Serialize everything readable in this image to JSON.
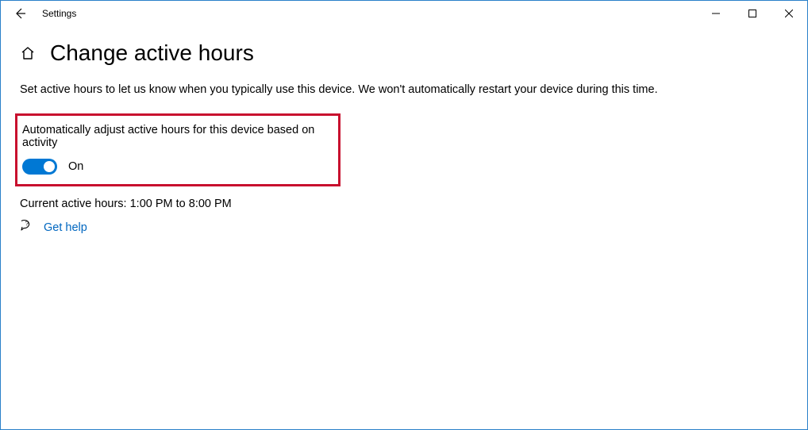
{
  "window": {
    "app_title": "Settings"
  },
  "page": {
    "heading": "Change active hours",
    "description": "Set active hours to let us know when you typically use this device. We won't automatically restart your device during this time."
  },
  "auto_adjust": {
    "label": "Automatically adjust active hours for this device based on activity",
    "state_text": "On",
    "enabled": true,
    "accent_color": "#0078d4"
  },
  "current_hours": {
    "text": "Current active hours: 1:00 PM to 8:00 PM",
    "start": "1:00 PM",
    "end": "8:00 PM"
  },
  "help": {
    "link_text": "Get help"
  },
  "highlight_color": "#c8102e"
}
